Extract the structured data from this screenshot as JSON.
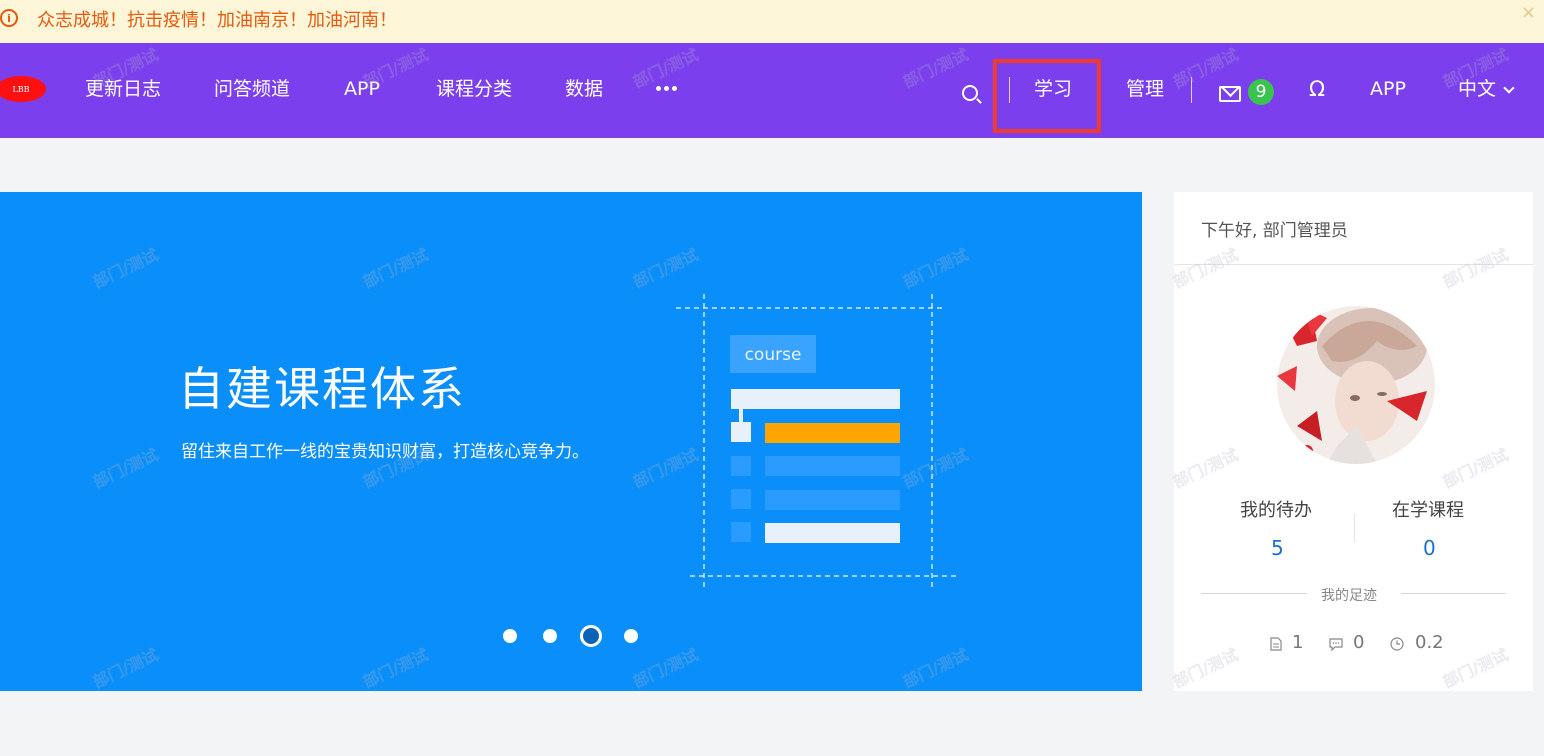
{
  "notice": {
    "text": "众志成城！抗击疫情！加油南京！加油河南！",
    "close_label": "×"
  },
  "nav": {
    "logo": "LBB",
    "items": [
      "更新日志",
      "问答频道",
      "APP",
      "课程分类",
      "数据"
    ],
    "right": {
      "learn": "学习",
      "manage": "管理",
      "mail_count": "9",
      "app": "APP",
      "language": "中文"
    }
  },
  "banner": {
    "title": "自建课程体系",
    "subtitle": "留住来自工作一线的宝贵知识财富，打造核心竞争力。",
    "illustration_tag": "course",
    "slide_count": 4,
    "active_slide": 3
  },
  "card": {
    "greeting": "下午好, 部门管理员",
    "todo_label": "我的待办",
    "todo_value": "5",
    "courses_label": "在学课程",
    "courses_value": "0",
    "footprint_title": "我的足迹",
    "footprints": [
      {
        "icon": "document-icon",
        "value": "1"
      },
      {
        "icon": "comment-icon",
        "value": "0"
      },
      {
        "icon": "clock-icon",
        "value": "0.2"
      }
    ]
  },
  "watermark": "部门/测试",
  "colors": {
    "nav": "#7b3fed",
    "banner": "#0a8ffa",
    "notice_bg": "#fdf6d8",
    "notice_text": "#e8590c",
    "highlight": "#ef3a2f",
    "badge": "#3bc34f",
    "stat_value": "#1a73c8"
  }
}
